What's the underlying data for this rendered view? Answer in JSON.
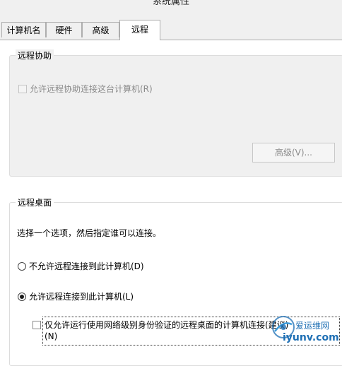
{
  "window": {
    "title": "系统属性"
  },
  "tabs": [
    {
      "label": "计算机名",
      "active": false
    },
    {
      "label": "硬件",
      "active": false
    },
    {
      "label": "高级",
      "active": false
    },
    {
      "label": "远程",
      "active": true
    }
  ],
  "remote_assistance": {
    "legend": "远程协助",
    "allow_checkbox": {
      "label": "允许远程协助连接这台计算机(R)",
      "checked": false,
      "enabled": false
    },
    "advanced_button": {
      "label": "高级(V)...",
      "enabled": false
    }
  },
  "remote_desktop": {
    "legend": "远程桌面",
    "instruction": "选择一个选项，然后指定谁可以连接。",
    "options": [
      {
        "label": "不允许远程连接到此计算机(D)",
        "selected": false
      },
      {
        "label": "允许远程连接到此计算机(L)",
        "selected": true
      }
    ],
    "nla_checkbox": {
      "label_line1": "仅允许运行使用网络级别身份验证的远程桌面的计算机连接(建议)",
      "label_line2": "(N)",
      "checked": false
    }
  },
  "watermark": {
    "line1": "爱运维网",
    "line2": "iyunv.com",
    "color": "#1e6fb4"
  }
}
